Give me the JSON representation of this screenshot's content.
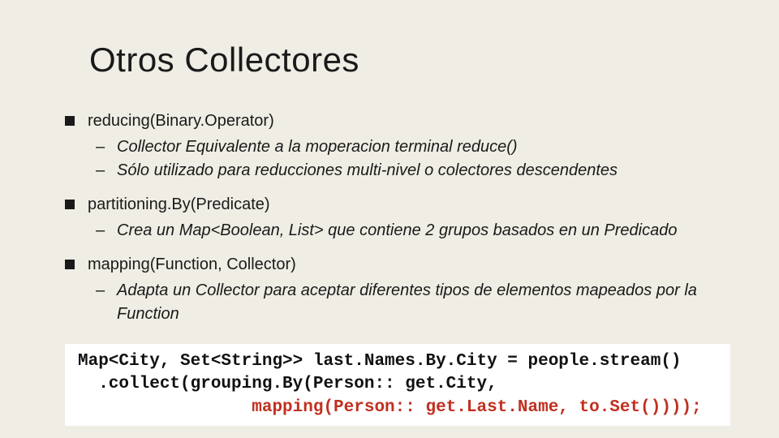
{
  "title": "Otros Collectores",
  "items": [
    {
      "heading": "reducing(Binary.Operator)",
      "sub": [
        "Collector Equivalente a la moperacion terminal reduce()",
        "Sólo utilizado para reducciones multi-nivel o colectores descendentes"
      ]
    },
    {
      "heading": "partitioning.By(Predicate)",
      "sub": [
        "Crea un Map<Boolean, List> que contiene 2 grupos basados en un Predicado"
      ]
    },
    {
      "heading": "mapping(Function, Collector)",
      "sub": [
        "Adapta un Collector para aceptar diferentes tipos de elementos mapeados por la Function"
      ]
    }
  ],
  "code": {
    "line1": "Map<City, Set<String>> last.Names.By.City = people.stream()",
    "line2a": "  .collect(grouping.By(Person:: get.City,",
    "line2b": "                 mapping(Person:: get.Last.Name, to.Set())));"
  }
}
